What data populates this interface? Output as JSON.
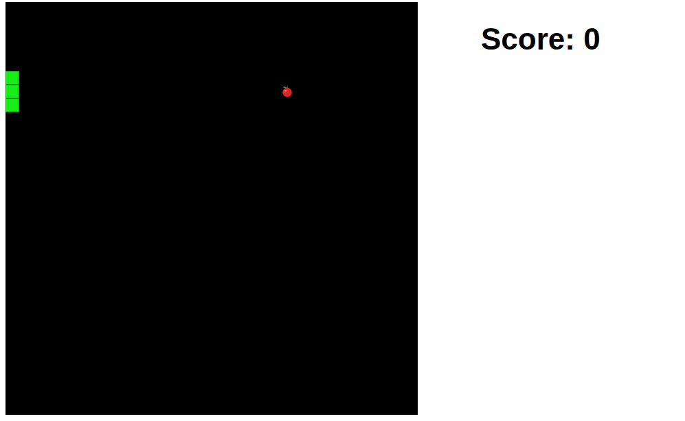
{
  "board": {
    "columns": 30,
    "rows": 30,
    "snake": [
      {
        "col": 0,
        "row": 5
      },
      {
        "col": 0,
        "row": 6
      },
      {
        "col": 0,
        "row": 7
      }
    ],
    "apple": {
      "col": 20,
      "row": 6
    }
  },
  "score": {
    "text": "Score: 0"
  }
}
